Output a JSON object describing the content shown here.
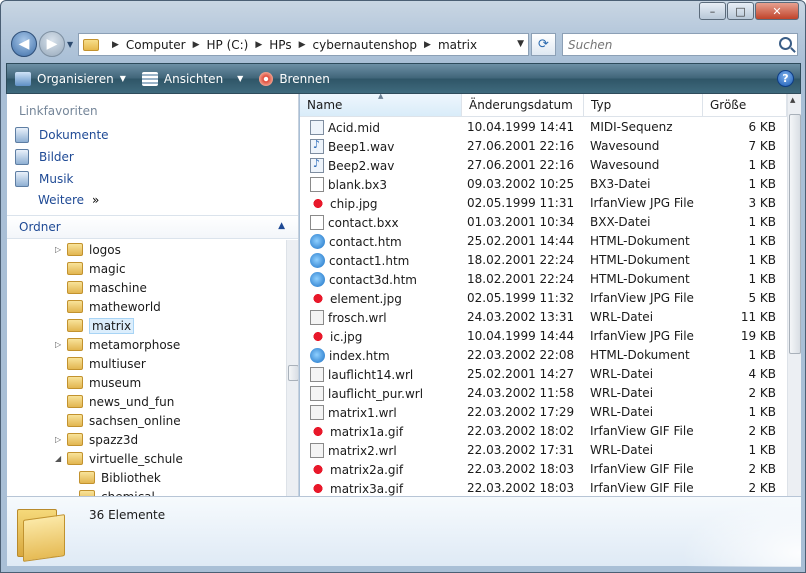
{
  "window": {
    "buttons": {
      "minimize": "–",
      "maximize": "□",
      "close": "✕"
    }
  },
  "address": {
    "breadcrumbs": [
      "Computer",
      "HP (C:)",
      "HPs",
      "cybernautenshop",
      "matrix"
    ],
    "search_placeholder": "Suchen"
  },
  "toolbar": {
    "organize": "Organisieren",
    "views": "Ansichten",
    "burn": "Brennen",
    "help": "?"
  },
  "sidebar": {
    "favorites_title": "Linkfavoriten",
    "favorites": [
      "Dokumente",
      "Bilder",
      "Musik"
    ],
    "more": "Weitere",
    "more_arrows": "»",
    "folders_title": "Ordner",
    "tree": [
      {
        "label": "logos",
        "expandable": true
      },
      {
        "label": "magic",
        "expandable": false
      },
      {
        "label": "maschine",
        "expandable": false
      },
      {
        "label": "matheworld",
        "expandable": false
      },
      {
        "label": "matrix",
        "expandable": false,
        "selected": true
      },
      {
        "label": "metamorphose",
        "expandable": true
      },
      {
        "label": "multiuser",
        "expandable": false
      },
      {
        "label": "museum",
        "expandable": false
      },
      {
        "label": "news_und_fun",
        "expandable": false
      },
      {
        "label": "sachsen_online",
        "expandable": false
      },
      {
        "label": "spazz3d",
        "expandable": true
      },
      {
        "label": "virtuelle_schule",
        "expandable": true,
        "expanded": true
      },
      {
        "label": "Bibliothek",
        "expandable": false,
        "child": true
      },
      {
        "label": "chemical",
        "expandable": false,
        "child": true
      }
    ]
  },
  "columns": {
    "name": "Name",
    "date": "Änderungsdatum",
    "type": "Typ",
    "size": "Größe"
  },
  "files": [
    {
      "name": "Acid.mid",
      "date": "10.04.1999 14:41",
      "type": "MIDI-Sequenz",
      "size": "6 KB",
      "icon": "mid"
    },
    {
      "name": "Beep1.wav",
      "date": "27.06.2001 22:16",
      "type": "Wavesound",
      "size": "7 KB",
      "icon": "wav"
    },
    {
      "name": "Beep2.wav",
      "date": "27.06.2001 22:16",
      "type": "Wavesound",
      "size": "1 KB",
      "icon": "wav"
    },
    {
      "name": "blank.bx3",
      "date": "09.03.2002 10:25",
      "type": "BX3-Datei",
      "size": "1 KB",
      "icon": "file"
    },
    {
      "name": "chip.jpg",
      "date": "02.05.1999 11:31",
      "type": "IrfanView JPG File",
      "size": "3 KB",
      "icon": "jpg"
    },
    {
      "name": "contact.bxx",
      "date": "01.03.2001 10:34",
      "type": "BXX-Datei",
      "size": "1 KB",
      "icon": "file"
    },
    {
      "name": "contact.htm",
      "date": "25.02.2001 14:44",
      "type": "HTML-Dokument",
      "size": "1 KB",
      "icon": "html"
    },
    {
      "name": "contact1.htm",
      "date": "18.02.2001 22:24",
      "type": "HTML-Dokument",
      "size": "1 KB",
      "icon": "html"
    },
    {
      "name": "contact3d.htm",
      "date": "18.02.2001 22:24",
      "type": "HTML-Dokument",
      "size": "1 KB",
      "icon": "html"
    },
    {
      "name": "element.jpg",
      "date": "02.05.1999 11:32",
      "type": "IrfanView JPG File",
      "size": "5 KB",
      "icon": "jpg"
    },
    {
      "name": "frosch.wrl",
      "date": "24.03.2002 13:31",
      "type": "WRL-Datei",
      "size": "11 KB",
      "icon": "wrl"
    },
    {
      "name": "ic.jpg",
      "date": "10.04.1999 14:44",
      "type": "IrfanView JPG File",
      "size": "19 KB",
      "icon": "jpg"
    },
    {
      "name": "index.htm",
      "date": "22.03.2002 22:08",
      "type": "HTML-Dokument",
      "size": "1 KB",
      "icon": "html"
    },
    {
      "name": "lauflicht14.wrl",
      "date": "25.02.2001 14:27",
      "type": "WRL-Datei",
      "size": "4 KB",
      "icon": "wrl"
    },
    {
      "name": "lauflicht_pur.wrl",
      "date": "24.03.2002 11:58",
      "type": "WRL-Datei",
      "size": "2 KB",
      "icon": "wrl"
    },
    {
      "name": "matrix1.wrl",
      "date": "22.03.2002 17:29",
      "type": "WRL-Datei",
      "size": "1 KB",
      "icon": "wrl"
    },
    {
      "name": "matrix1a.gif",
      "date": "22.03.2002 18:02",
      "type": "IrfanView GIF File",
      "size": "2 KB",
      "icon": "gif"
    },
    {
      "name": "matrix2.wrl",
      "date": "22.03.2002 17:31",
      "type": "WRL-Datei",
      "size": "1 KB",
      "icon": "wrl"
    },
    {
      "name": "matrix2a.gif",
      "date": "22.03.2002 18:03",
      "type": "IrfanView GIF File",
      "size": "2 KB",
      "icon": "gif"
    },
    {
      "name": "matrix3a.gif",
      "date": "22.03.2002 18:03",
      "type": "IrfanView GIF File",
      "size": "2 KB",
      "icon": "gif"
    }
  ],
  "status": {
    "count": "36 Elemente"
  }
}
